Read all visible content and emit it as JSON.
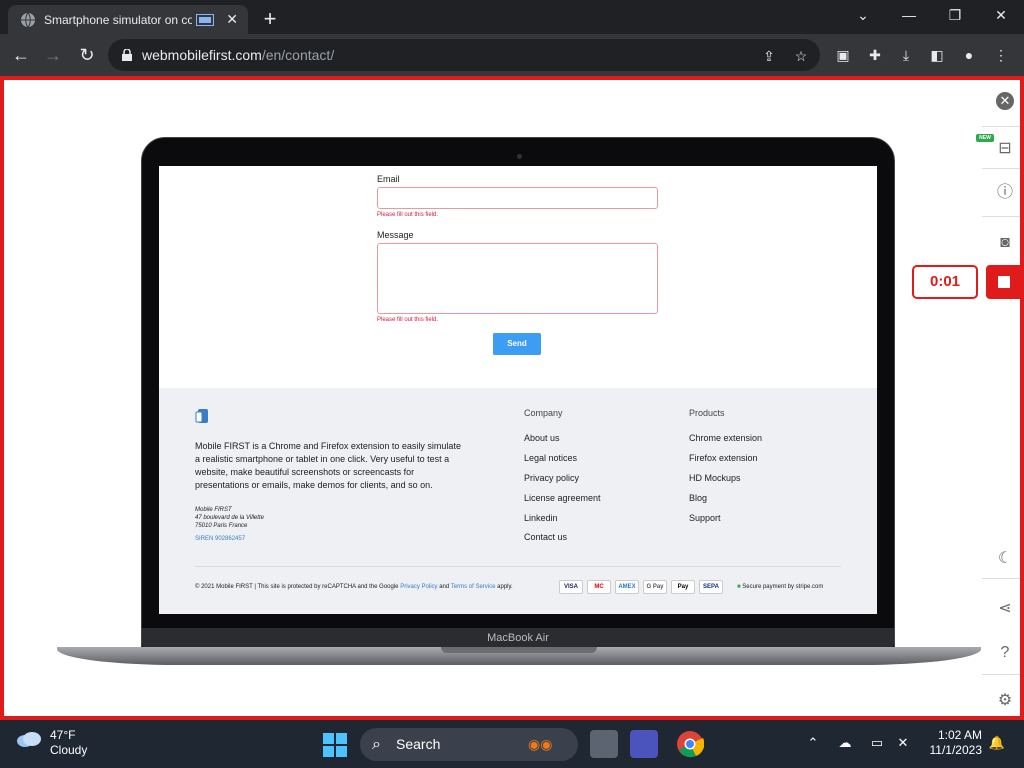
{
  "browser": {
    "tab_title": "Smartphone simulator on co",
    "url_host": "webmobilefirst.com",
    "url_path": "/en/contact/"
  },
  "form": {
    "email_label": "Email",
    "email_value": "",
    "email_error": "Please fill out this field.",
    "message_label": "Message",
    "message_value": "",
    "message_error": "Please fill out this field.",
    "send_label": "Send"
  },
  "footer": {
    "description": "Mobile FIRST is a Chrome and Firefox extension to easily simulate a realistic smartphone or tablet in one click. Very useful to test a website, make beautiful screenshots or screencasts for presentations or emails, make demos for clients, and so on.",
    "address_line1": "Mobile FIRST",
    "address_line2": "47 boulevard de la Villette",
    "address_line3": "75010 Paris France",
    "siren": "SIREN 902862457",
    "company_heading": "Company",
    "company_links": [
      "About us",
      "Legal notices",
      "Privacy policy",
      "License agreement",
      "Linkedin",
      "Contact us"
    ],
    "products_heading": "Products",
    "products_links": [
      "Chrome extension",
      "Firefox extension",
      "HD Mockups",
      "Blog",
      "Support"
    ],
    "copyright_text": "© 2021 Mobile FIRST | This site is protected by reCAPTCHA and the Google",
    "privacy_link": "Privacy Policy",
    "and_text": "and",
    "terms_link": "Terms of Service",
    "apply_text": "apply.",
    "payment_methods": [
      "VISA",
      "MC",
      "AMEX",
      "G Pay",
      "Pay",
      "SEPA"
    ],
    "secure_text": "Secure payment by stripe.com"
  },
  "device": {
    "label": "MacBook Air"
  },
  "right_controls": {
    "new_badge": "NEW",
    "timer": "0:01"
  },
  "taskbar": {
    "weather_temp": "47°F",
    "weather_desc": "Cloudy",
    "search_label": "Search",
    "time": "1:02 AM",
    "date": "11/1/2023"
  },
  "colors": {
    "record_red": "#e01b1b",
    "send_blue": "#3d9df3",
    "error_red": "#d21c3c"
  }
}
